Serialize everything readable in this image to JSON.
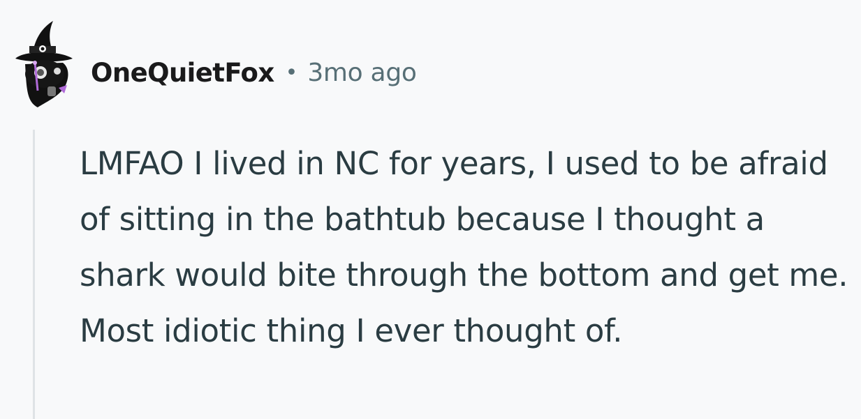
{
  "comment": {
    "author": "OneQuietFox",
    "separator": "•",
    "timestamp": "3mo ago",
    "body": "LMFAO I lived in NC for years, I used to be afraid of sitting in the bathtub because I thought a shark would bite through the bottom and get me. Most idiotic thing I ever thought of.",
    "avatar_icon": "witch-hat-avatar-icon"
  },
  "colors": {
    "background": "#f8f9fa",
    "author": "#1a1a1b",
    "meta": "#576f76",
    "body_text": "#2a3c42",
    "thread_line": "#dfe3e6",
    "avatar_accent": "#b06ad8"
  }
}
